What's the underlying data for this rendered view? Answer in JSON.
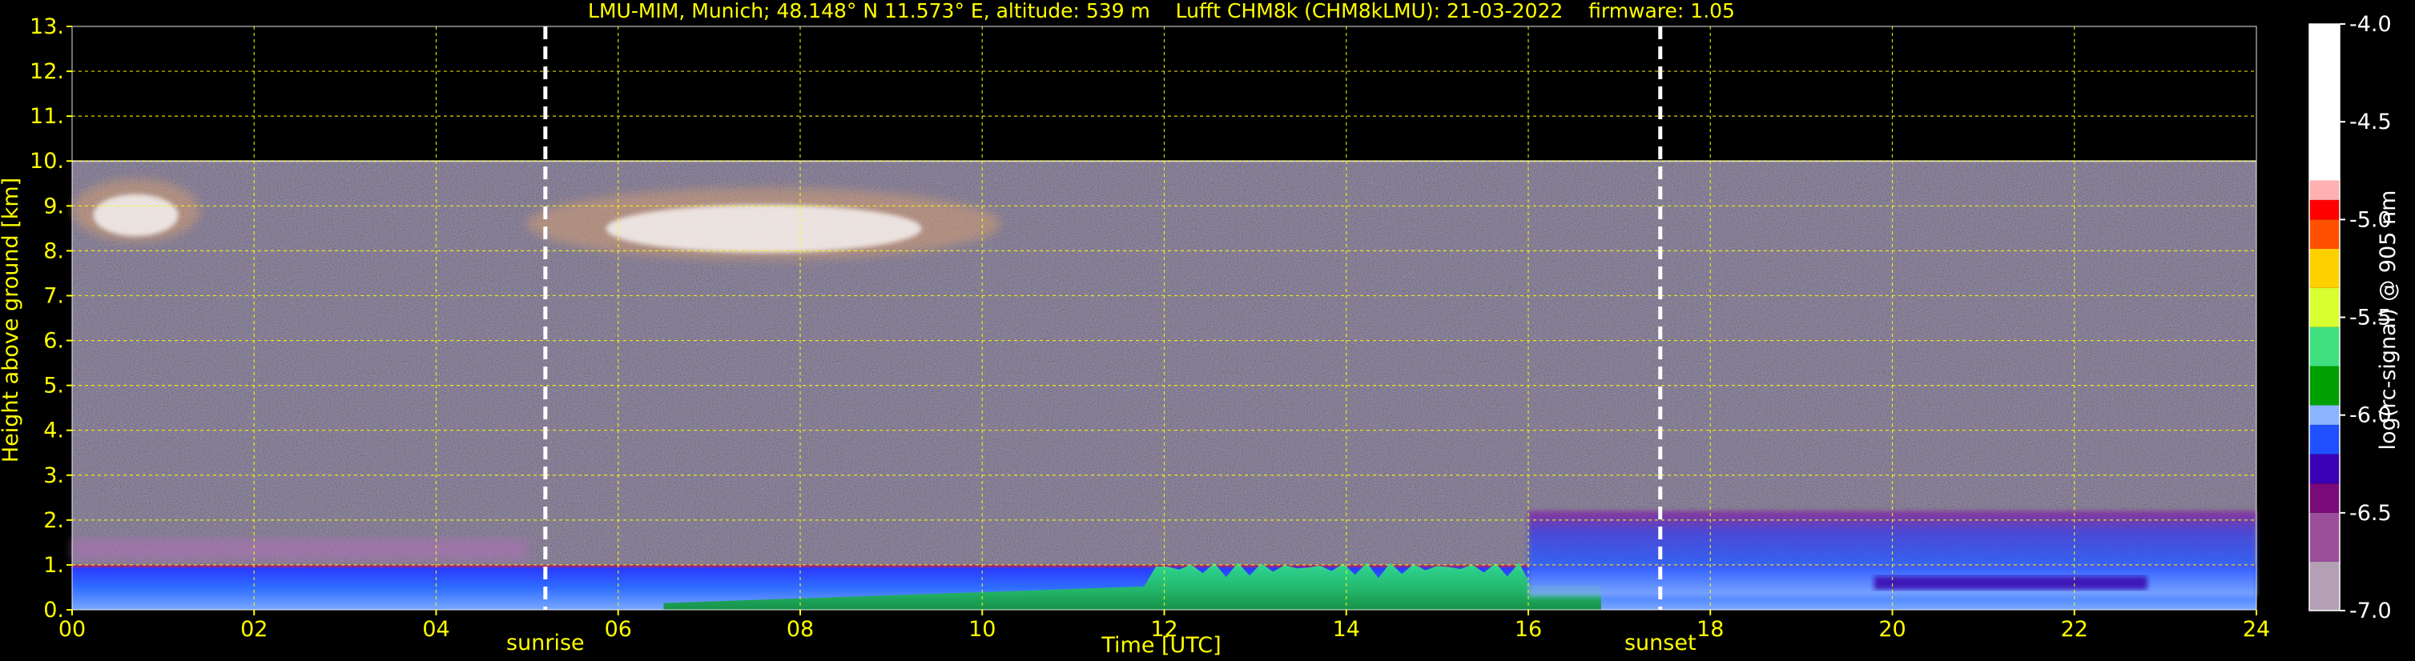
{
  "chart_data": {
    "type": "heatmap",
    "title": "LMU-MIM, Munich; 48.148° N 11.573° E, altitude: 539 m    Lufft CHM8k (CHM8kLMU): 21-03-2022    firmware: 1.05",
    "xlabel": "Time [UTC]",
    "ylabel": "Height above ground [km]",
    "xlim": [
      0,
      24
    ],
    "ylim": [
      0,
      13
    ],
    "x_ticks": [
      0,
      2,
      4,
      6,
      8,
      10,
      12,
      14,
      16,
      18,
      20,
      22,
      24
    ],
    "x_tick_labels": [
      "00",
      "02",
      "04",
      "06",
      "08",
      "10",
      "12",
      "14",
      "16",
      "18",
      "20",
      "22",
      "24"
    ],
    "y_ticks": [
      0,
      1,
      2,
      3,
      4,
      5,
      6,
      7,
      8,
      9,
      10,
      11,
      12,
      13
    ],
    "y_tick_labels": [
      "0.",
      "1.",
      "2.",
      "3.",
      "4.",
      "5.",
      "6.",
      "7.",
      "8.",
      "9.",
      "10.",
      "11.",
      "12.",
      "13."
    ],
    "grid": true,
    "data_top_km": 10,
    "annotations": [
      {
        "label": "sunrise",
        "time": 5.2
      },
      {
        "label": "sunset",
        "time": 17.45
      }
    ],
    "colorbar": {
      "label": "log(rc-signal) @ 905 nm",
      "min": -7.0,
      "max": -4.0,
      "ticks": [
        -4.0,
        -4.5,
        -5.0,
        -5.5,
        -6.0,
        -6.5,
        -7.0
      ],
      "tick_labels": [
        "-4.0",
        "-4.5",
        "-5.0",
        "-5.5",
        "-6.0",
        "-6.5",
        "-7.0"
      ],
      "stops": [
        {
          "value": -7.0,
          "color": "#b4a0b4"
        },
        {
          "value": -6.75,
          "color": "#9b4f9b"
        },
        {
          "value": -6.5,
          "color": "#7a0a7a"
        },
        {
          "value": -6.35,
          "color": "#3a00b4"
        },
        {
          "value": -6.2,
          "color": "#1e50ff"
        },
        {
          "value": -6.05,
          "color": "#8ab4ff"
        },
        {
          "value": -5.95,
          "color": "#00a000"
        },
        {
          "value": -5.75,
          "color": "#40e080"
        },
        {
          "value": -5.55,
          "color": "#d8ff30"
        },
        {
          "value": -5.35,
          "color": "#ffd000"
        },
        {
          "value": -5.15,
          "color": "#ff5000"
        },
        {
          "value": -5.0,
          "color": "#ff0000"
        },
        {
          "value": -4.9,
          "color": "#ffb0b0"
        },
        {
          "value": -4.8,
          "color": "#ffffff"
        },
        {
          "value": -4.0,
          "color": "#ffffff"
        }
      ]
    },
    "features": [
      {
        "name": "boundary layer (blue)",
        "t_start": 0,
        "t_end": 24,
        "h_min": 0.0,
        "h_max": 1.0,
        "color": "#2a5cff"
      },
      {
        "name": "aerosol layer (purple)",
        "t_start": 0,
        "t_end": 5,
        "h_min": 1.1,
        "h_max": 1.6,
        "color": "#b070b8"
      },
      {
        "name": "convective layer (green)",
        "t_start": 6.5,
        "t_end": 16.8,
        "h_min": 0.0,
        "h_max": 1.1,
        "color": "#2ec070"
      },
      {
        "name": "residual layer (blue/purple)",
        "t_start": 16,
        "t_end": 24,
        "h_min": 0.3,
        "h_max": 2.2,
        "color": "#3a40e0"
      },
      {
        "name": "cirrus cloud",
        "t_start": 0,
        "t_end": 1.4,
        "h_min": 8.2,
        "h_max": 9.6,
        "color": "#ffffff"
      },
      {
        "name": "cirrus cloud",
        "t_start": 5.0,
        "t_end": 10.2,
        "h_min": 7.8,
        "h_max": 9.4,
        "color": "#ffffff"
      }
    ]
  }
}
